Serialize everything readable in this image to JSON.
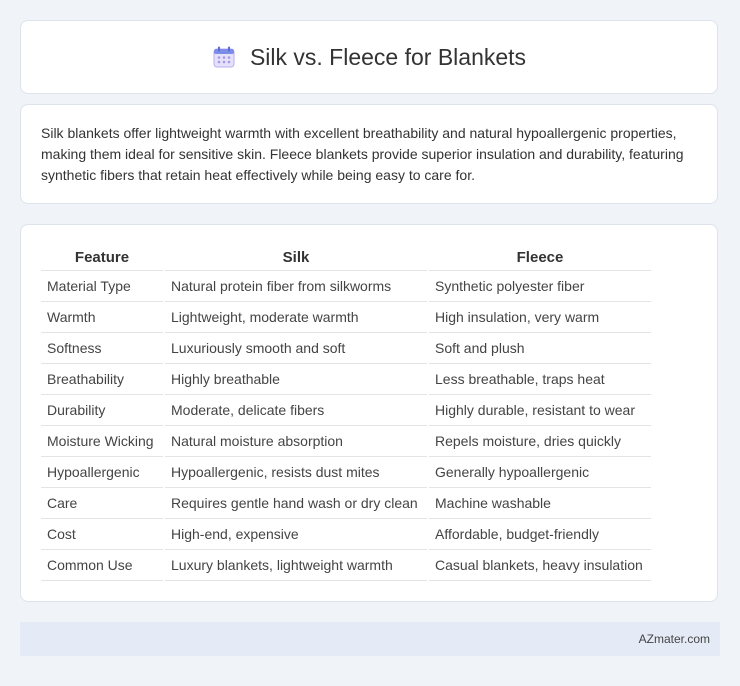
{
  "header": {
    "title": "Silk vs. Fleece for Blankets",
    "icon": "calendar-icon"
  },
  "summary": {
    "text": "Silk blankets offer lightweight warmth with excellent breathability and natural hypoallergenic properties, making them ideal for sensitive skin. Fleece blankets provide superior insulation and durability, featuring synthetic fibers that retain heat effectively while being easy to care for."
  },
  "table": {
    "headers": [
      "Feature",
      "Silk",
      "Fleece"
    ],
    "rows": [
      [
        "Material Type",
        "Natural protein fiber from silkworms",
        "Synthetic polyester fiber"
      ],
      [
        "Warmth",
        "Lightweight, moderate warmth",
        "High insulation, very warm"
      ],
      [
        "Softness",
        "Luxuriously smooth and soft",
        "Soft and plush"
      ],
      [
        "Breathability",
        "Highly breathable",
        "Less breathable, traps heat"
      ],
      [
        "Durability",
        "Moderate, delicate fibers",
        "Highly durable, resistant to wear"
      ],
      [
        "Moisture Wicking",
        "Natural moisture absorption",
        "Repels moisture, dries quickly"
      ],
      [
        "Hypoallergenic",
        "Hypoallergenic, resists dust mites",
        "Generally hypoallergenic"
      ],
      [
        "Care",
        "Requires gentle hand wash or dry clean",
        "Machine washable"
      ],
      [
        "Cost",
        "High-end, expensive",
        "Affordable, budget-friendly"
      ],
      [
        "Common Use",
        "Luxury blankets, lightweight warmth",
        "Casual blankets, heavy insulation"
      ]
    ]
  },
  "footer": {
    "text": "AZmater.com"
  },
  "colors": {
    "background": "#f0f3f8",
    "footer_bg": "#e5ebf6",
    "icon_accent": "#7b6fd6"
  }
}
